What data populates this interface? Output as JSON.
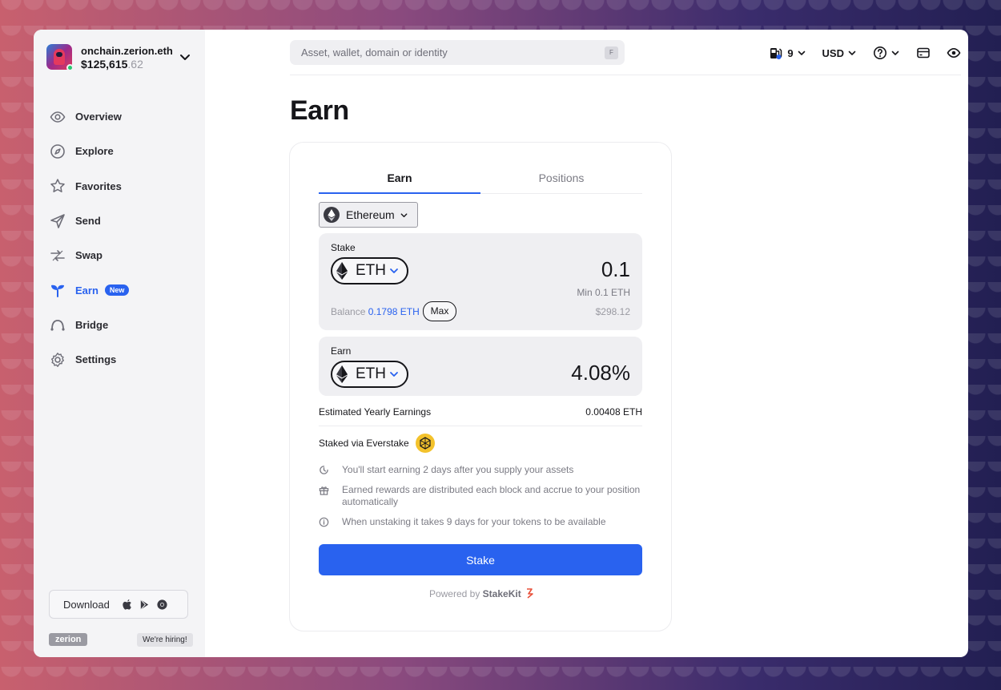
{
  "account": {
    "name": "onchain.zerion.eth",
    "balance_main": "$125,615",
    "balance_cents": ".62"
  },
  "sidebar": {
    "items": [
      {
        "label": "Overview",
        "icon": "eye-icon"
      },
      {
        "label": "Explore",
        "icon": "compass-icon"
      },
      {
        "label": "Favorites",
        "icon": "star-icon"
      },
      {
        "label": "Send",
        "icon": "send-icon"
      },
      {
        "label": "Swap",
        "icon": "swap-icon"
      },
      {
        "label": "Earn",
        "icon": "sprout-icon",
        "active": true,
        "badge": "New"
      },
      {
        "label": "Bridge",
        "icon": "bridge-icon"
      },
      {
        "label": "Settings",
        "icon": "gear-icon"
      }
    ],
    "download_label": "Download",
    "brand": "zerion",
    "hiring": "We're hiring!"
  },
  "topbar": {
    "search_placeholder": "Asset, wallet, domain or identity",
    "search_shortcut": "F",
    "gas": "9",
    "currency": "USD"
  },
  "page": {
    "title": "Earn"
  },
  "earn_card": {
    "tabs": [
      "Earn",
      "Positions"
    ],
    "active_tab": "Earn",
    "network": "Ethereum",
    "stake": {
      "label": "Stake",
      "token": "ETH",
      "amount": "0.1",
      "min": "Min 0.1 ETH",
      "balance_label": "Balance",
      "balance_value": "0.1798 ETH",
      "max_label": "Max",
      "usd_value": "$298.12"
    },
    "earn": {
      "label": "Earn",
      "token": "ETH",
      "apy": "4.08%"
    },
    "estimated_label": "Estimated Yearly Earnings",
    "estimated_value": "0.00408 ETH",
    "via_label": "Staked via Everstake",
    "info": [
      "You'll start earning 2 days after you supply your assets",
      "Earned rewards are distributed each block and accrue to your position automatically",
      "When unstaking it takes 9 days for your tokens to be available"
    ],
    "stake_button": "Stake",
    "powered_prefix": "Powered by",
    "powered_brand": "StakeKit"
  },
  "colors": {
    "accent": "#2962ef",
    "sidebar_bg": "#f4f4f6",
    "panel_bg": "#efeff2",
    "everstake": "#f3c22c"
  }
}
